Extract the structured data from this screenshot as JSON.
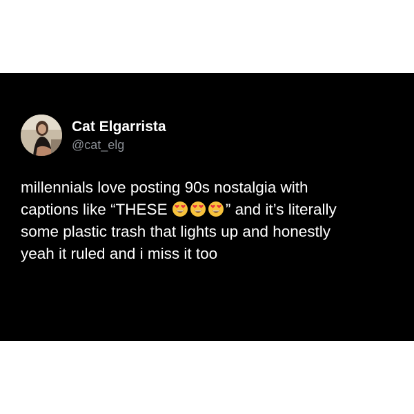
{
  "post": {
    "author": {
      "display_name": "Cat Elgarrista",
      "handle": "@cat_elg",
      "avatar_icon": "profile-photo"
    },
    "body": {
      "line1": "millennials love posting 90s nostalgia with",
      "line2_before": "captions like “THESE ",
      "emoji": [
        "heart-eyes-emoji",
        "heart-eyes-emoji",
        "heart-eyes-emoji"
      ],
      "line2_after": "” and it’s literally",
      "line3": "some plastic trash that lights up and honestly",
      "line4": "yeah it ruled and i miss it too"
    },
    "colors": {
      "card_background": "#000000",
      "text": "#ffffff",
      "handle": "#8b8f95",
      "emoji_face": "#f7c23c",
      "emoji_heart": "#e8323b"
    }
  }
}
